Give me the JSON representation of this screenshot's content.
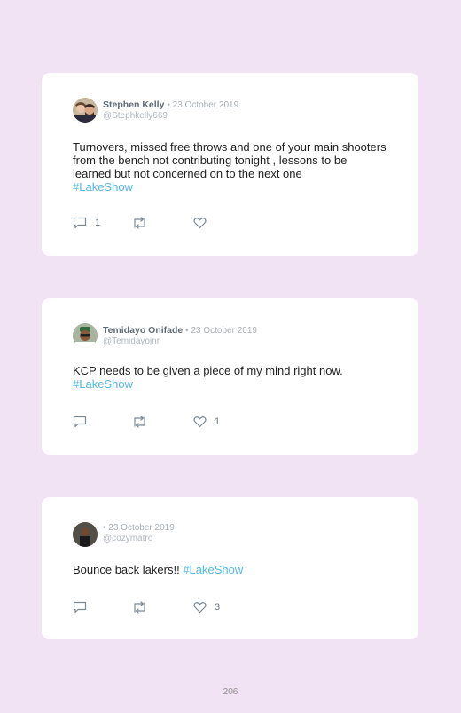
{
  "tweets": [
    {
      "name": "Stephen Kelly",
      "date": "• 23 October 2019",
      "handle": "@Stephkelly669",
      "text": "Turnovers, missed free throws and one of your main shooters from the bench not contributing tonight , lessons to be learned but not concerned on to the next one",
      "hashtag": "#LakeShow",
      "replies": "1",
      "retweets": "",
      "likes": ""
    },
    {
      "name": "Temidayo Onifade",
      "date": "• 23 October 2019",
      "handle": "@Temidayojnr",
      "text": "KCP needs to be given a piece of my mind right now.",
      "hashtag": "#LakeShow",
      "replies": "",
      "retweets": "",
      "likes": "1"
    },
    {
      "name": "",
      "date": "• 23 October 2019",
      "handle": "@cozymatro",
      "text": "Bounce back lakers!!",
      "hashtag": "#LakeShow",
      "replies": "",
      "retweets": "",
      "likes": "3"
    }
  ],
  "page_number": "206",
  "icons": {
    "reply": "speech-bubble-icon",
    "retweet": "retweet-icon",
    "like": "heart-icon"
  },
  "colors": {
    "background": "#f1e3f3",
    "hashtag": "#55b8e4"
  }
}
